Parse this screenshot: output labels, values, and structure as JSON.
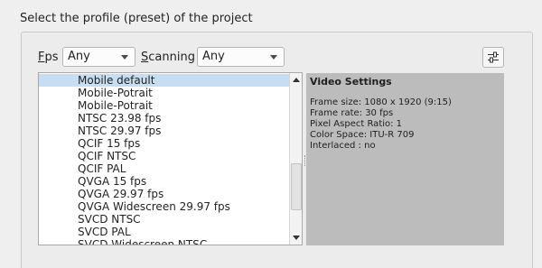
{
  "heading": "Select the profile (preset) of the project",
  "filters": {
    "fps_label": "Fps",
    "fps_value": "Any",
    "scanning_label": "Scanning",
    "scanning_value": "Any",
    "settings_button_icon": "sliders-icon"
  },
  "profiles": [
    {
      "label": "Mobile default",
      "selected": true
    },
    {
      "label": "Mobile-Potrait",
      "selected": false
    },
    {
      "label": "Mobile-Potrait",
      "selected": false
    },
    {
      "label": "NTSC 23.98 fps",
      "selected": false
    },
    {
      "label": "NTSC 29.97 fps",
      "selected": false
    },
    {
      "label": "QCIF 15 fps",
      "selected": false
    },
    {
      "label": "QCIF NTSC",
      "selected": false
    },
    {
      "label": "QCIF PAL",
      "selected": false
    },
    {
      "label": "QVGA 15 fps",
      "selected": false
    },
    {
      "label": "QVGA 29.97 fps",
      "selected": false
    },
    {
      "label": "QVGA Widescreen 29.97 fps",
      "selected": false
    },
    {
      "label": "SVCD NTSC",
      "selected": false
    },
    {
      "label": "SVCD PAL",
      "selected": false
    },
    {
      "label": "SVCD Widescreen NTSC",
      "selected": false
    }
  ],
  "details": {
    "title": "Video Settings",
    "frame_size": "Frame size: 1080 x 1920 (9:15)",
    "frame_rate": "Frame rate: 30 fps",
    "pixel_aspect": "Pixel Aspect Ratio: 1",
    "color_space": "Color Space: ITU-R 709",
    "interlaced": "Interlaced : no"
  },
  "colors": {
    "selection": "#c7ddf2",
    "details_bg": "#bcbcbc",
    "window_bg": "#efefef"
  }
}
